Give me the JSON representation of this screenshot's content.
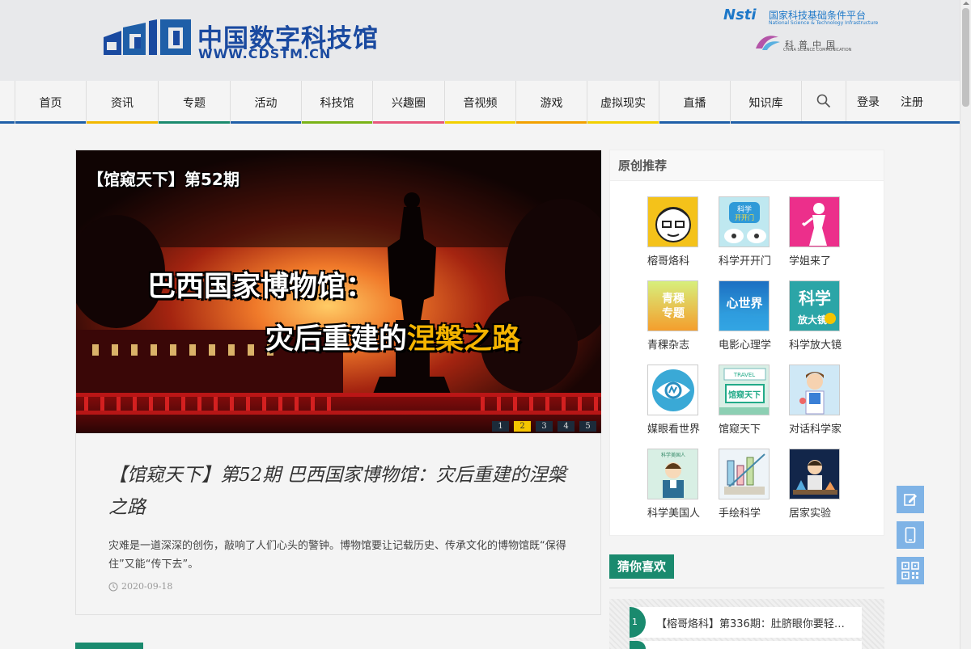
{
  "header": {
    "logo_cn": "中国数字科技馆",
    "logo_url": "WWW.CDSTM.CN",
    "partner1_mark": "Nsti",
    "partner1_cn": "国家科技基础条件平台",
    "partner1_en": "National Science & Technology Infrastructure",
    "partner2_cn": "科普中国",
    "partner2_en": "CHINA SCIENCE COMMUNICATION"
  },
  "nav": {
    "items": [
      {
        "label": "首页",
        "color": "#1f5fa8"
      },
      {
        "label": "资讯",
        "color": "#f2b800"
      },
      {
        "label": "专题",
        "color": "#1a8a6e"
      },
      {
        "label": "活动",
        "color": "#1f5fa8"
      },
      {
        "label": "科技馆",
        "color": "#7ab317"
      },
      {
        "label": "兴趣圈",
        "color": "#e8567c"
      },
      {
        "label": "音视频",
        "color": "#f2d000"
      },
      {
        "label": "游戏",
        "color": "#f2a100"
      },
      {
        "label": "虚拟现实",
        "color": "#f2d000"
      },
      {
        "label": "直播",
        "color": "#1f5fa8"
      },
      {
        "label": "知识库",
        "color": ""
      }
    ],
    "search_icon": "search-icon",
    "login": "登录",
    "register": "注册"
  },
  "main": {
    "banner": {
      "tag": "【馆窥天下】第52期",
      "title_line1": "巴西国家博物馆：",
      "title_line2_a": "灾后重建的",
      "title_line2_b": "涅槃之路"
    },
    "slides": [
      "1",
      "2",
      "3",
      "4",
      "5"
    ],
    "active_slide": 2,
    "title": "【馆窥天下】第52期 巴西国家博物馆：灾后重建的涅槃之路",
    "desc": "灾难是一道深深的创伤，敲响了人们心头的警钟。博物馆要让记载历史、传承文化的博物馆既“保得住”又能“传下去”。",
    "date": "2020-09-18"
  },
  "sidebar": {
    "title": "原创推荐",
    "items": [
      {
        "label": "榕哥烙科",
        "icon": "cartoon-face-icon"
      },
      {
        "label": "科学开开门",
        "icon": "science-door-icon"
      },
      {
        "label": "学姐来了",
        "icon": "woman-silhouette-icon"
      },
      {
        "label": "青稞杂志",
        "icon": "magazine-icon"
      },
      {
        "label": "电影心理学",
        "icon": "heart-world-icon"
      },
      {
        "label": "科学放大镜",
        "icon": "magnifier-icon"
      },
      {
        "label": "媒眼看世界",
        "icon": "eye-icon"
      },
      {
        "label": "馆窥天下",
        "icon": "museum-icon"
      },
      {
        "label": "对话科学家",
        "icon": "scientist-icon"
      },
      {
        "label": "科学美国人",
        "icon": "robot-icon"
      },
      {
        "label": "手绘科学",
        "icon": "hand-drawn-icon"
      },
      {
        "label": "居家实验",
        "icon": "experiment-icon"
      }
    ]
  },
  "guess": {
    "title": "猜你喜欢",
    "items": [
      {
        "num": "1",
        "text": "【榕哥烙科】第336期：肚脐眼你要轻…"
      }
    ]
  },
  "floating": {
    "edit_icon": "edit-icon",
    "mobile_icon": "mobile-icon",
    "qr_icon": "qr-code-icon"
  }
}
